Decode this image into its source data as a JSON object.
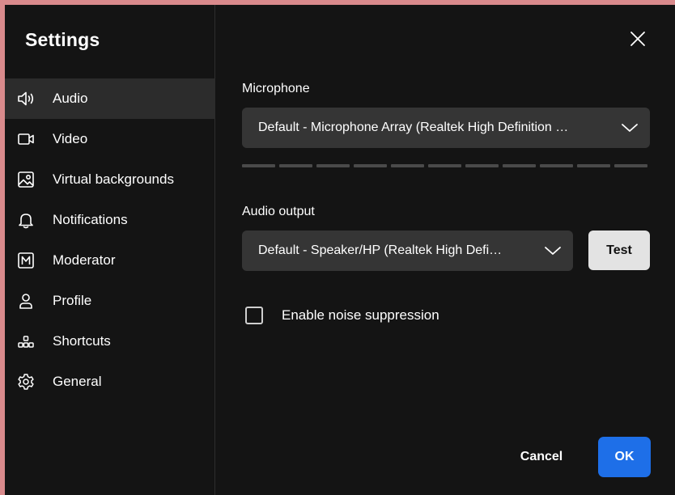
{
  "dialog": {
    "title": "Settings",
    "close_icon": "close-icon"
  },
  "sidebar": {
    "items": [
      {
        "label": "Audio",
        "icon": "speaker-icon",
        "active": true
      },
      {
        "label": "Video",
        "icon": "video-camera-icon",
        "active": false
      },
      {
        "label": "Virtual backgrounds",
        "icon": "image-icon",
        "active": false
      },
      {
        "label": "Notifications",
        "icon": "bell-icon",
        "active": false
      },
      {
        "label": "Moderator",
        "icon": "moderator-icon",
        "active": false
      },
      {
        "label": "Profile",
        "icon": "person-icon",
        "active": false
      },
      {
        "label": "Shortcuts",
        "icon": "shortcuts-icon",
        "active": false
      },
      {
        "label": "General",
        "icon": "gear-icon",
        "active": false
      }
    ]
  },
  "audio": {
    "microphone_label": "Microphone",
    "microphone_value": "Default - Microphone Array (Realtek High Definition …",
    "level_meter_segments": 11,
    "level_meter_active": 0,
    "output_label": "Audio output",
    "output_value": "Default - Speaker/HP (Realtek High Defi…",
    "test_label": "Test",
    "noise_suppression_label": "Enable noise suppression",
    "noise_suppression_checked": false
  },
  "footer": {
    "cancel_label": "Cancel",
    "ok_label": "OK"
  },
  "colors": {
    "background": "#141414",
    "active_item": "#2c2c2c",
    "select_bg": "#353535",
    "primary": "#1e6fe8",
    "test_button": "#e3e3e3",
    "frame": "#d98a8c"
  }
}
